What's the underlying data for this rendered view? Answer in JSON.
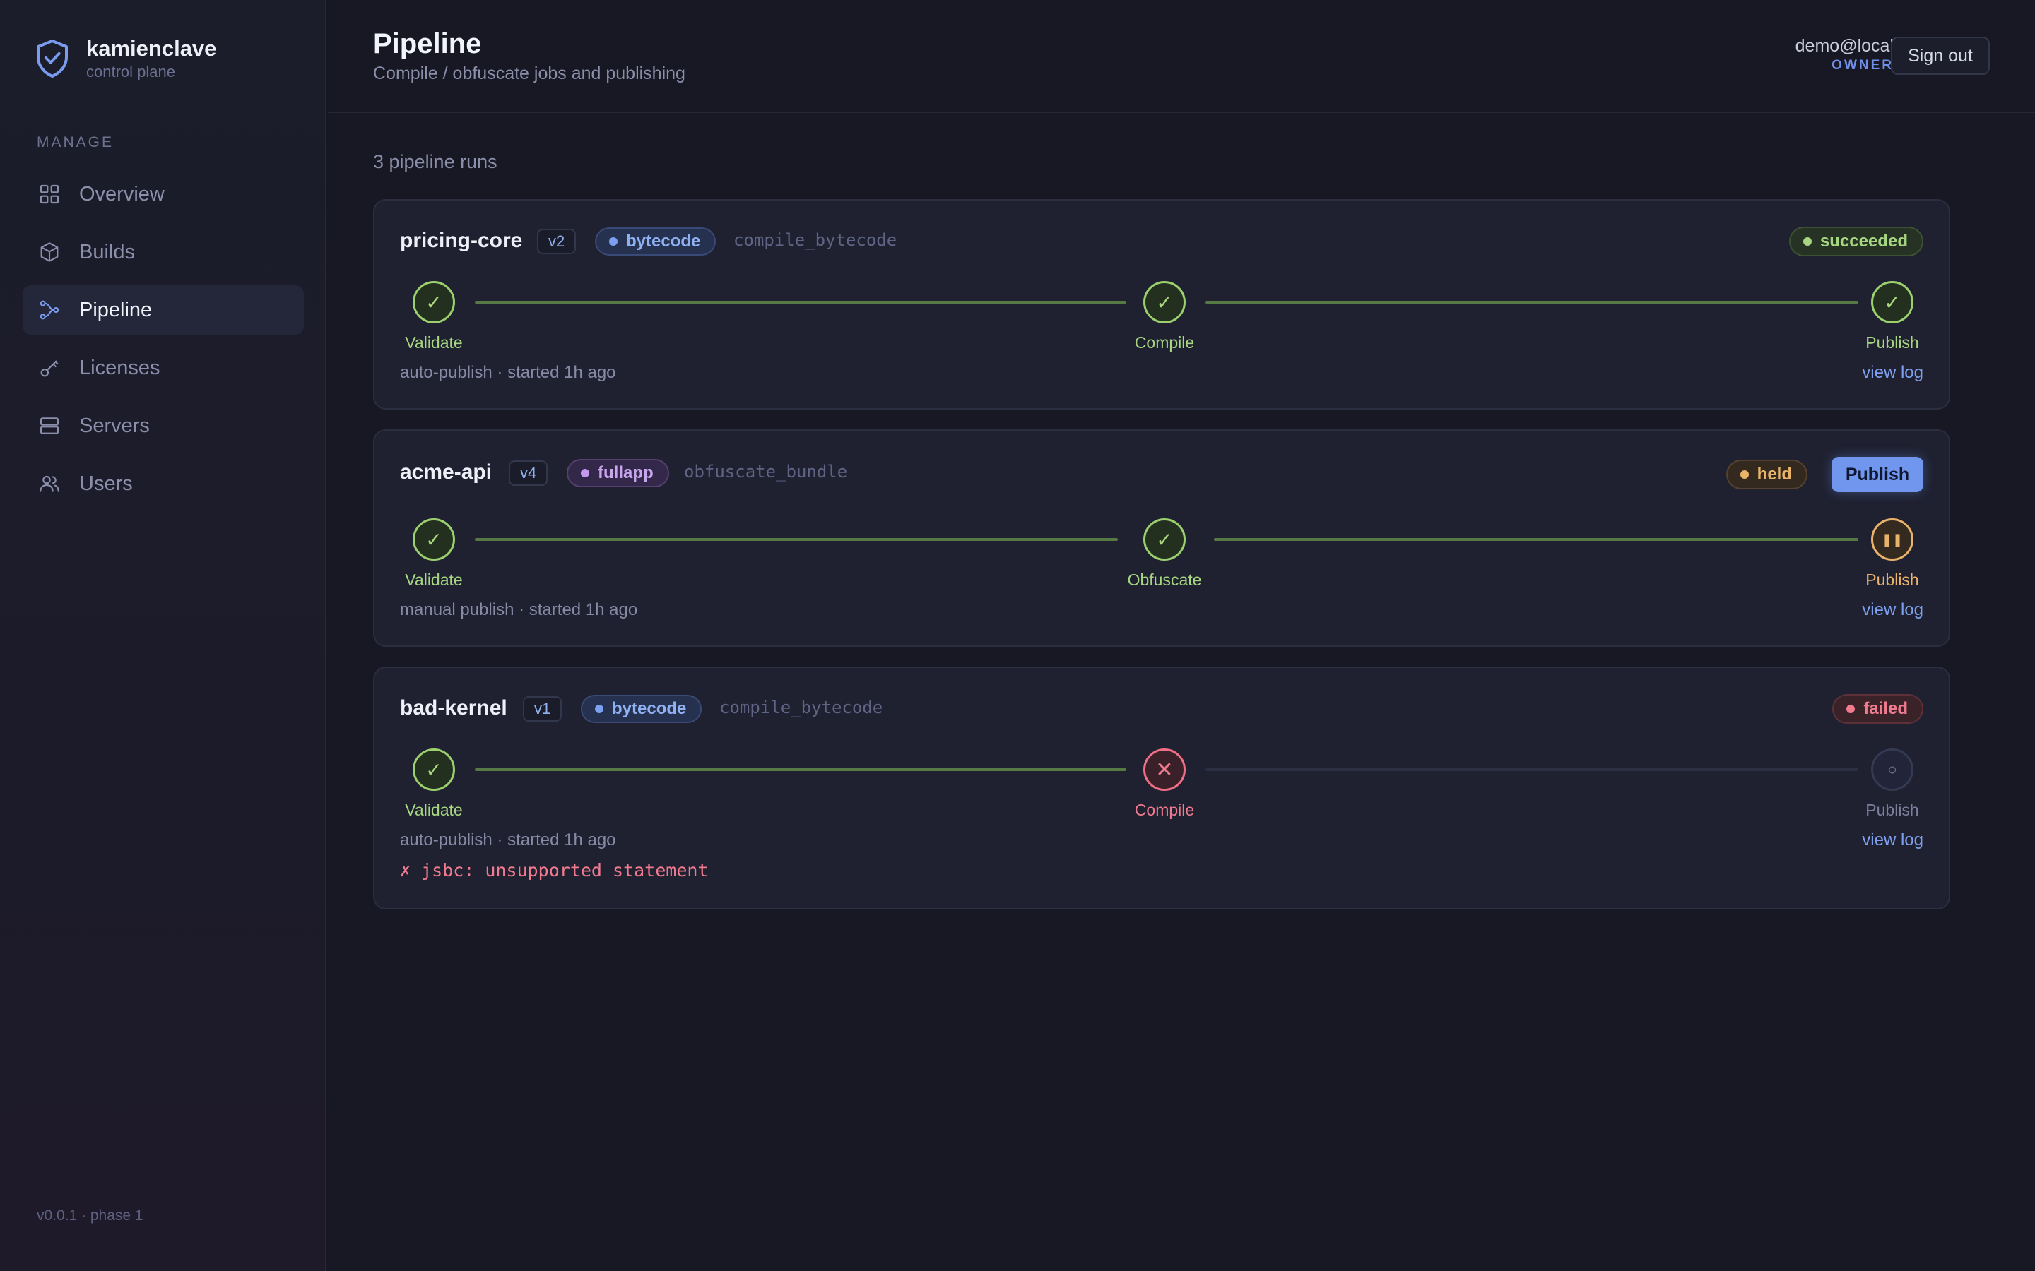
{
  "brand": {
    "name": "kamienclave",
    "subtitle": "control plane"
  },
  "sidebar": {
    "heading": "MANAGE",
    "items": [
      {
        "label": "Overview",
        "icon": "grid-icon"
      },
      {
        "label": "Builds",
        "icon": "cube-icon"
      },
      {
        "label": "Pipeline",
        "icon": "pipeline-icon",
        "active": true
      },
      {
        "label": "Licenses",
        "icon": "key-icon"
      },
      {
        "label": "Servers",
        "icon": "server-icon"
      },
      {
        "label": "Users",
        "icon": "users-icon"
      }
    ],
    "version": "v0.0.1 · phase 1"
  },
  "header": {
    "title": "Pipeline",
    "subtitle": "Compile / obfuscate jobs and publishing",
    "user_email": "demo@local",
    "user_role": "OWNER",
    "signout_label": "Sign out"
  },
  "runs_count": "3 pipeline runs",
  "runs": [
    {
      "name": "pricing-core",
      "version": "v2",
      "kind": "bytecode",
      "job": "compile_bytecode",
      "status": "succeeded",
      "steps": [
        {
          "label": "Validate",
          "state": "ok",
          "glyph": "✓"
        },
        {
          "label": "Compile",
          "state": "ok",
          "glyph": "✓"
        },
        {
          "label": "Publish",
          "state": "ok",
          "glyph": "✓"
        }
      ],
      "meta": "auto-publish · started 1h ago",
      "view_log": "view log"
    },
    {
      "name": "acme-api",
      "version": "v4",
      "kind": "fullapp",
      "job": "obfuscate_bundle",
      "status": "held",
      "action_label": "Publish",
      "steps": [
        {
          "label": "Validate",
          "state": "ok",
          "glyph": "✓"
        },
        {
          "label": "Obfuscate",
          "state": "ok",
          "glyph": "✓"
        },
        {
          "label": "Publish",
          "state": "hold",
          "glyph": "❚❚"
        }
      ],
      "meta": "manual publish · started 1h ago",
      "view_log": "view log"
    },
    {
      "name": "bad-kernel",
      "version": "v1",
      "kind": "bytecode",
      "job": "compile_bytecode",
      "status": "failed",
      "steps": [
        {
          "label": "Validate",
          "state": "ok",
          "glyph": "✓"
        },
        {
          "label": "Compile",
          "state": "fail",
          "glyph": "✕"
        },
        {
          "label": "Publish",
          "state": "pend",
          "glyph": "○"
        }
      ],
      "meta": "auto-publish · started 1h ago",
      "view_log": "view log",
      "error": "✗ jsbc: unsupported statement"
    }
  ],
  "colors": {
    "accent": "#7196ee",
    "success": "#a6d680",
    "warning": "#e9b36a",
    "danger": "#f07a8e"
  }
}
